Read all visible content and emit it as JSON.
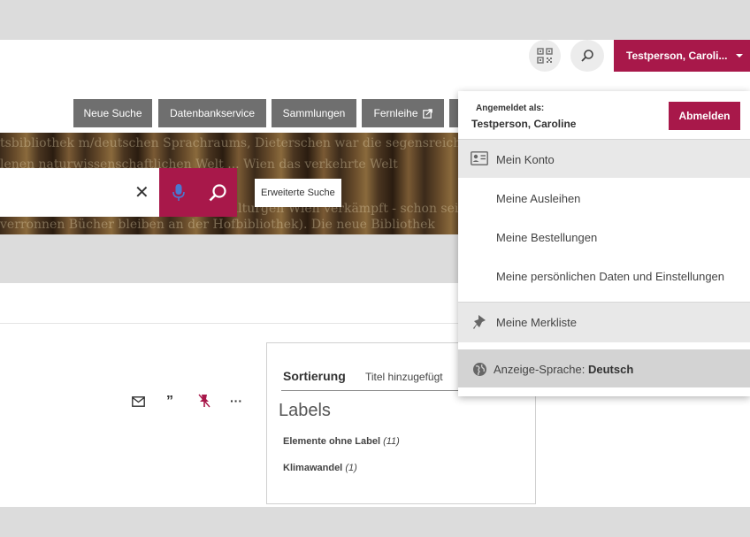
{
  "header": {
    "user_button_label": "Testperson, Caroli..."
  },
  "nav": {
    "buttons": [
      "Neue Suche",
      "Datenbankservice",
      "Sammlungen",
      "Fernleihe"
    ]
  },
  "banner": {
    "lines": [
      "tsbibliothek m/deutschen Sprachraums, Dieterschen war die segensreich",
      "lenen naturwissenschaftlichen Welt ... Wien das verkehrte Welt",
      "den Kelchen der Bibliotheksankeitskulturgen Wien verkämpft - schon seit dem",
      "verronnen Bücher bleiben an der Hofbibliothek). Die neue Bibliothek"
    ]
  },
  "search": {
    "advanced_label": "Erweiterte Suche"
  },
  "panel": {
    "sort_title": "Sortierung",
    "sort_value": "Titel hinzugefügt",
    "labels_heading": "Labels",
    "labels": [
      {
        "name": "Elemente ohne Label",
        "count": "(11)"
      },
      {
        "name": "Klimawandel",
        "count": "(1)"
      }
    ]
  },
  "dropdown": {
    "logged_in_label": "Angemeldet als:",
    "user_name": "Testperson, Caroline",
    "logout_label": "Abmelden",
    "my_account": "Mein Konto",
    "loans": "Meine Ausleihen",
    "orders": "Meine Bestellungen",
    "personal_data": "Meine persönlichen Daten und Einstellungen",
    "watchlist": "Meine Merkliste",
    "language_label": "Anzeige-Sprache:",
    "language_value": "Deutsch"
  },
  "colors": {
    "accent": "#a8184a",
    "nav_gray": "#6f6f6f",
    "background_gray": "#dcdcdc"
  },
  "icons": [
    "qr-code-icon",
    "search-icon",
    "chevron-down-icon",
    "external-link-icon",
    "clear-icon",
    "microphone-icon",
    "mail-icon",
    "quote-icon",
    "unpin-icon",
    "more-icon",
    "id-card-icon",
    "pin-icon",
    "globe-icon"
  ]
}
